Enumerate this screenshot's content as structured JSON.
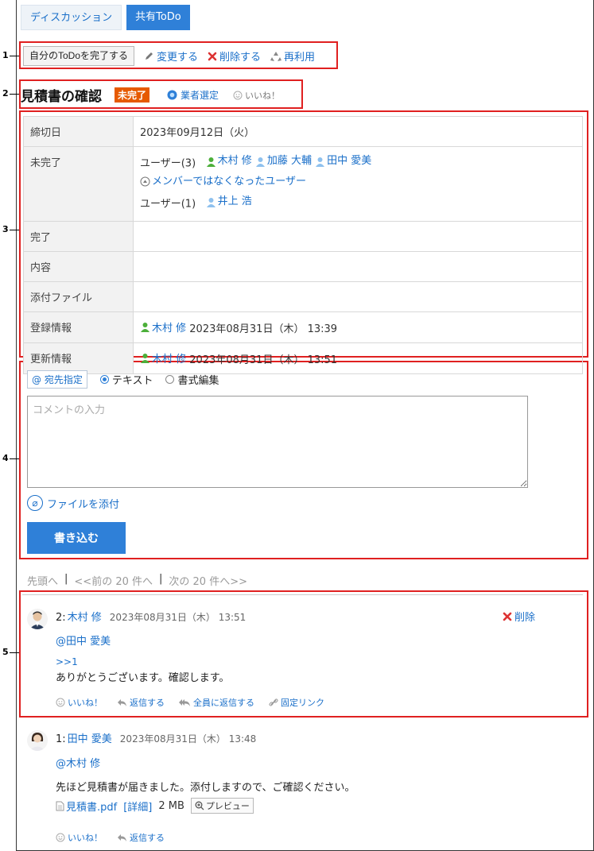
{
  "tabs": [
    {
      "label": "ディスカッション"
    },
    {
      "label": "共有ToDo"
    }
  ],
  "callouts": [
    "1",
    "2",
    "3",
    "4",
    "5"
  ],
  "actions": {
    "complete": "自分のToDoを完了する",
    "edit": "変更する",
    "delete": "削除する",
    "reuse": "再利用"
  },
  "todo": {
    "title": "見積書の確認",
    "status": "未完了",
    "category": "業者選定",
    "like": "いいね！"
  },
  "info": {
    "deadline_label": "締切日",
    "deadline": "2023年09月12日（火）",
    "incomplete_label": "未完了",
    "users3_label": "ユーザー(3)",
    "users3": [
      "木村 修",
      "加藤 大輔",
      "田中 愛美"
    ],
    "ex_member": "メンバーではなくなったユーザー",
    "users1_label": "ユーザー(1)",
    "users1": [
      "井上 浩"
    ],
    "complete_label": "完了",
    "content_label": "内容",
    "attach_label": "添付ファイル",
    "registered_label": "登録情報",
    "registered_user": "木村 修",
    "registered_date": "2023年08月31日（木） 13:39",
    "updated_label": "更新情報",
    "updated_user": "木村 修",
    "updated_date": "2023年08月31日（木） 13:51"
  },
  "comment_form": {
    "dest_button": "@ 宛先指定",
    "radio_text": "テキスト",
    "radio_rich": "書式編集",
    "placeholder": "コメントの入力",
    "attach": "ファイルを添付",
    "submit": "書き込む"
  },
  "pager": {
    "first": "先頭へ",
    "sep": "|",
    "prev": "<<前の 20 件へ",
    "next": "次の 20 件へ>>"
  },
  "posts": [
    {
      "num": "2:",
      "author": "木村 修",
      "date": "2023年08月31日（木） 13:51",
      "mention": "@田中 愛美",
      "reply_ref": ">>1",
      "text": "ありがとうございます。確認します。",
      "delete": "削除",
      "like": "いいね！",
      "reply": "返信する",
      "reply_all": "全員に返信する",
      "permalink": "固定リンク"
    },
    {
      "num": "1:",
      "author": "田中 愛美",
      "date": "2023年08月31日（木） 13:48",
      "mention": "@木村 修",
      "text": "先ほど見積書が届きました。添付しますので、ご確認ください。",
      "file": "見積書.pdf",
      "detail": "[詳細]",
      "size": "2 MB",
      "preview": "プレビュー",
      "like": "いいね！",
      "reply": "返信する"
    }
  ]
}
